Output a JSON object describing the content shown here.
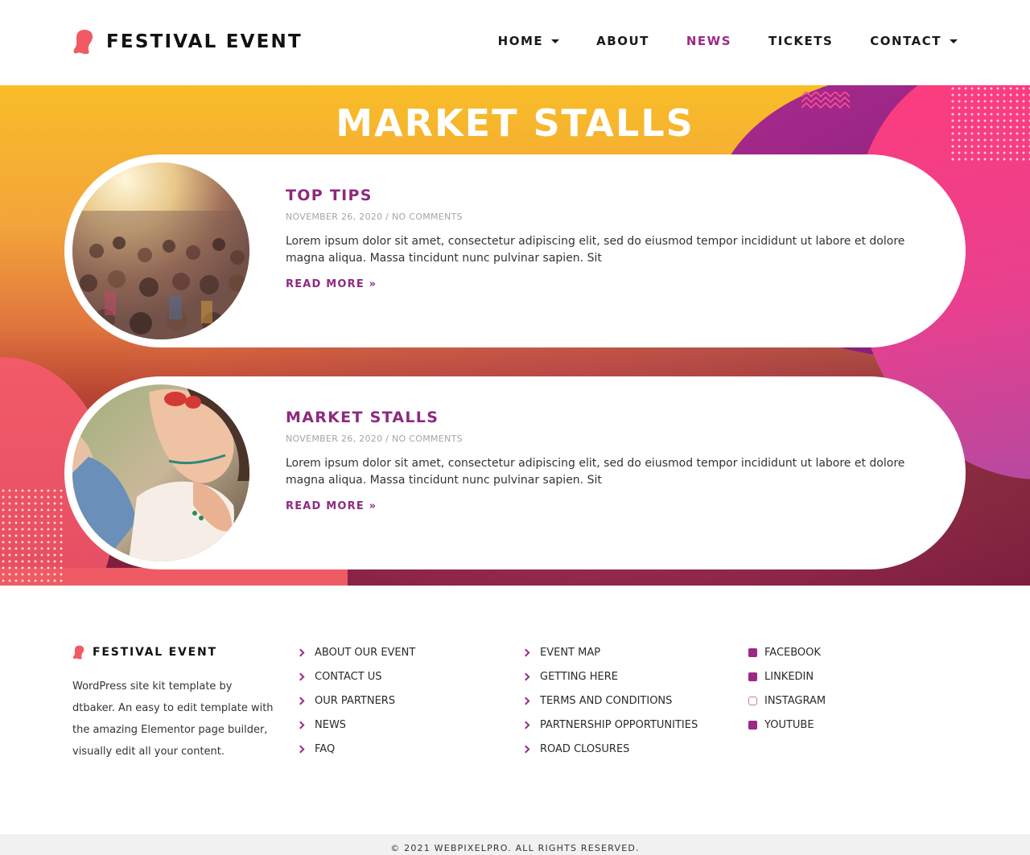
{
  "brand": {
    "name": "FESTIVAL EVENT",
    "accent_color": "#9b2a86",
    "logo_color": "#ef5a64"
  },
  "nav": {
    "items": [
      {
        "label": "HOME",
        "has_dropdown": true,
        "active": false
      },
      {
        "label": "ABOUT",
        "has_dropdown": false,
        "active": false
      },
      {
        "label": "NEWS",
        "has_dropdown": false,
        "active": true
      },
      {
        "label": "TICKETS",
        "has_dropdown": false,
        "active": false
      },
      {
        "label": "CONTACT",
        "has_dropdown": true,
        "active": false
      }
    ]
  },
  "hero": {
    "title": "MARKET STALLS"
  },
  "posts": [
    {
      "title": "TOP TIPS",
      "date": "NOVEMBER 26, 2020",
      "separator": " / ",
      "comments": "NO COMMENTS",
      "excerpt": "Lorem ipsum dolor sit amet, consectetur adipiscing elit, sed do eiusmod tempor incididunt ut labore et dolore magna aliqua. Massa tincidunt nunc pulvinar sapien. Sit",
      "read_more": "READ MORE »",
      "image": "festival-crowd-photo"
    },
    {
      "title": "MARKET STALLS",
      "date": "NOVEMBER 26, 2020",
      "separator": " / ",
      "comments": "NO COMMENTS",
      "excerpt": "Lorem ipsum dolor sit amet, consectetur adipiscing elit, sed do eiusmod tempor incididunt ut labore et dolore magna aliqua. Massa tincidunt nunc pulvinar sapien. Sit",
      "read_more": "READ MORE »",
      "image": "woman-sunglasses-photo"
    }
  ],
  "footer": {
    "brand": "FESTIVAL EVENT",
    "description": "WordPress site kit template by dtbaker. An easy to edit template with the amazing Elementor page builder, visually edit all your content.",
    "links_col1": [
      "ABOUT OUR EVENT",
      "CONTACT US",
      "OUR PARTNERS",
      "NEWS",
      "FAQ"
    ],
    "links_col2": [
      "EVENT MAP",
      "GETTING HERE",
      "TERMS AND CONDITIONS",
      "PARTNERSHIP OPPORTUNITIES",
      "ROAD CLOSURES"
    ],
    "social": [
      {
        "label": "FACEBOOK",
        "icon": "facebook-icon"
      },
      {
        "label": "LINKEDIN",
        "icon": "linkedin-icon"
      },
      {
        "label": "INSTAGRAM",
        "icon": "instagram-icon"
      },
      {
        "label": "YOUTUBE",
        "icon": "youtube-icon"
      }
    ],
    "copyright": "© 2021 WEBPIXELPRO. ALL RIGHTS RESERVED."
  }
}
